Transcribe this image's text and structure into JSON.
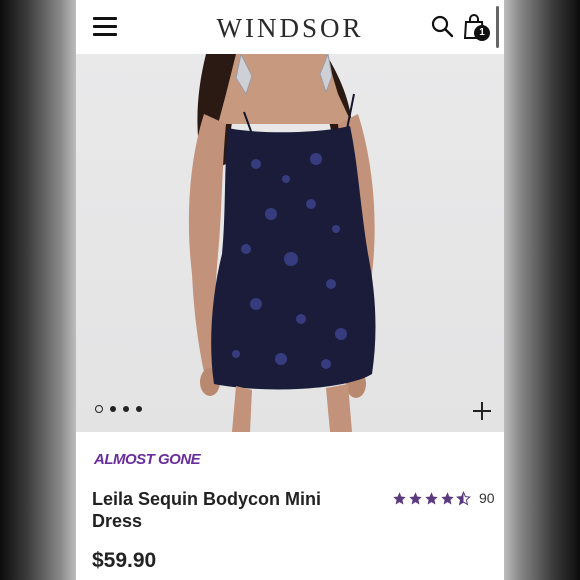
{
  "header": {
    "brand": "WINDSOR",
    "cart_count": "1"
  },
  "gallery": {
    "image_count": 4,
    "active_index": 0
  },
  "product": {
    "status": "ALMOST GONE",
    "name": "Leila Sequin Bodycon Mini Dress",
    "rating_value": 4.5,
    "rating_count": "90",
    "price": "$59.90"
  },
  "colors": {
    "accent_purple": "#6a2d9c",
    "star_color": "#5b3a7e",
    "dress_navy": "#1a1c3a"
  }
}
